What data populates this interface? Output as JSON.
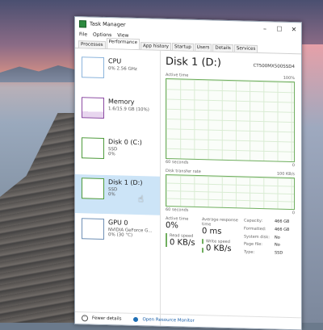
{
  "window": {
    "title": "Task Manager"
  },
  "menu": [
    "File",
    "Options",
    "View"
  ],
  "tabs": [
    "Processes",
    "Performance",
    "App history",
    "Startup",
    "Users",
    "Details",
    "Services"
  ],
  "resources": [
    {
      "name": "CPU",
      "sub": "0%  2.56 GHz"
    },
    {
      "name": "Memory",
      "sub": "1.6/15.9 GB (10%)"
    },
    {
      "name": "Disk 0 (C:)",
      "sub": "SSD",
      "sub2": "0%"
    },
    {
      "name": "Disk 1 (D:)",
      "sub": "SSD",
      "sub2": "0%"
    },
    {
      "name": "GPU 0",
      "sub": "NVIDIA GeForce G...",
      "sub2": "0% (30 °C)"
    }
  ],
  "detail": {
    "title": "Disk 1 (D:)",
    "model": "CT500MX500SSD4",
    "active_time_label": "Active time",
    "active_time_max": "100%",
    "axis_left": "60 seconds",
    "axis_right": "0",
    "transfer_label": "Disk transfer rate",
    "transfer_max": "100 KB/s",
    "stats": {
      "active_time_label": "Active time",
      "active_time_value": "0%",
      "response_label": "Average response time",
      "response_value": "0 ms",
      "read_label": "Read speed",
      "read_value": "0 KB/s",
      "write_label": "Write speed",
      "write_value": "0 KB/s"
    },
    "props": [
      {
        "k": "Capacity:",
        "v": "466 GB"
      },
      {
        "k": "Formatted:",
        "v": "466 GB"
      },
      {
        "k": "System disk:",
        "v": "No"
      },
      {
        "k": "Page file:",
        "v": "No"
      },
      {
        "k": "Type:",
        "v": "SSD"
      }
    ]
  },
  "footer": {
    "fewer": "Fewer details",
    "monitor": "Open Resource Monitor"
  }
}
